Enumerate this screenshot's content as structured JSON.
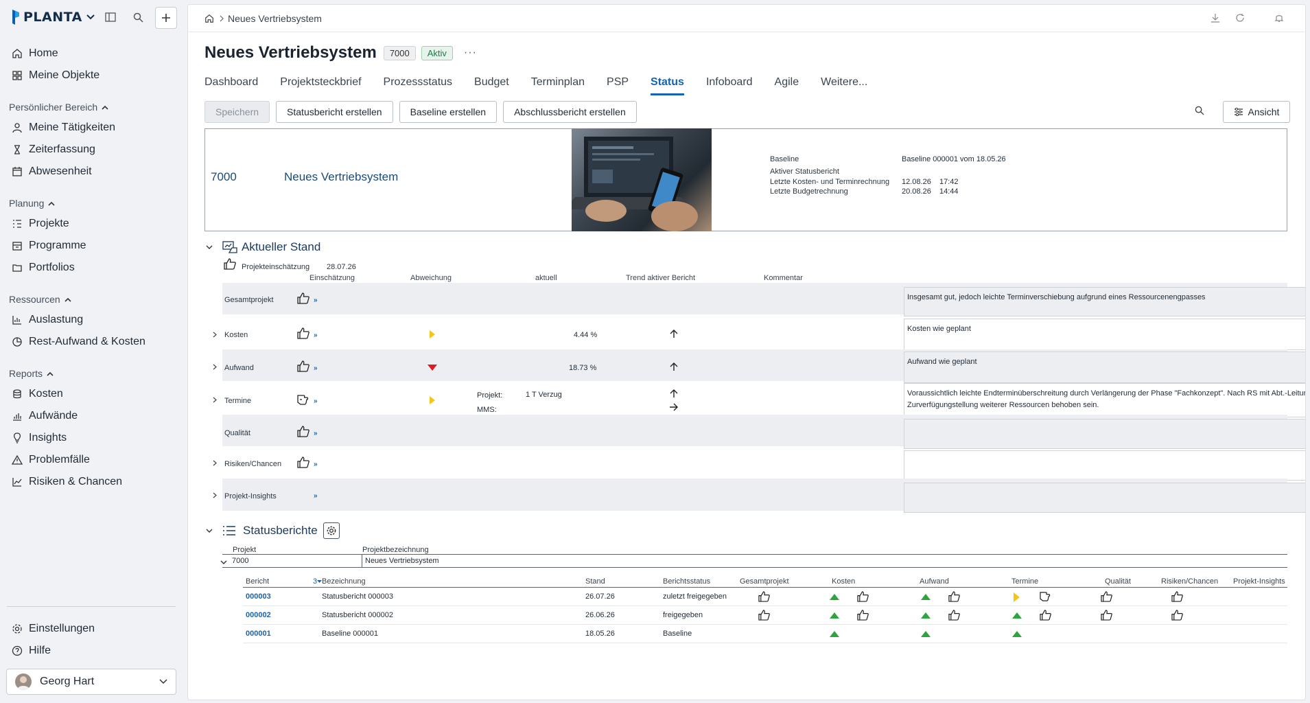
{
  "app": {
    "logo": "PLANTA"
  },
  "sidebar": {
    "top_items": [
      {
        "label": "Home",
        "icon": "home-icon"
      },
      {
        "label": "Meine Objekte",
        "icon": "grid-icon"
      }
    ],
    "sections": [
      {
        "title": "Persönlicher Bereich",
        "items": [
          {
            "label": "Meine Tätigkeiten",
            "icon": "person-icon"
          },
          {
            "label": "Zeiterfassung",
            "icon": "hourglass-icon"
          },
          {
            "label": "Abwesenheit",
            "icon": "calendar-icon"
          }
        ]
      },
      {
        "title": "Planung",
        "items": [
          {
            "label": "Projekte",
            "icon": "list-tree-icon"
          },
          {
            "label": "Programme",
            "icon": "programs-icon"
          },
          {
            "label": "Portfolios",
            "icon": "folder-icon"
          }
        ]
      },
      {
        "title": "Ressourcen",
        "items": [
          {
            "label": "Auslastung",
            "icon": "bar-chart-icon"
          },
          {
            "label": "Rest-Aufwand & Kosten",
            "icon": "pie-chart-icon"
          }
        ]
      },
      {
        "title": "Reports",
        "items": [
          {
            "label": "Kosten",
            "icon": "coins-icon"
          },
          {
            "label": "Aufwände",
            "icon": "effort-icon"
          },
          {
            "label": "Insights",
            "icon": "bulb-icon"
          },
          {
            "label": "Problemfälle",
            "icon": "warning-icon"
          },
          {
            "label": "Risiken & Chancen",
            "icon": "trend-icon"
          }
        ]
      }
    ],
    "bottom_items": [
      {
        "label": "Einstellungen",
        "icon": "gear-icon"
      },
      {
        "label": "Hilfe",
        "icon": "help-icon"
      }
    ],
    "user": {
      "name": "Georg Hart"
    }
  },
  "breadcrumb": {
    "current": "Neues Vertriebsystem"
  },
  "page": {
    "title": "Neues Vertriebsystem",
    "id": "7000",
    "status": "Aktiv",
    "more": "···"
  },
  "tabs": [
    {
      "label": "Dashboard"
    },
    {
      "label": "Projektsteckbrief"
    },
    {
      "label": "Prozessstatus"
    },
    {
      "label": "Budget"
    },
    {
      "label": "Terminplan"
    },
    {
      "label": "PSP"
    },
    {
      "label": "Status",
      "active": true
    },
    {
      "label": "Infoboard"
    },
    {
      "label": "Agile"
    },
    {
      "label": "Weitere..."
    }
  ],
  "toolbar": {
    "save": "Speichern",
    "create_status": "Statusbericht erstellen",
    "create_baseline": "Baseline erstellen",
    "create_final": "Abschlussbericht erstellen",
    "view": "Ansicht"
  },
  "header_card": {
    "id": "7000",
    "name": "Neues Vertriebsystem",
    "baseline_label": "Baseline",
    "baseline_value": "Baseline 000001 vom 18.05.26",
    "active_report_label": "Aktiver Statusbericht",
    "last_cost_label": "Letzte Kosten- und Terminrechnung",
    "last_cost_date": "12.08.26",
    "last_cost_time": "17:42",
    "last_budget_label": "Letzte Budgetrechnung",
    "last_budget_date": "20.08.26",
    "last_budget_time": "14:44"
  },
  "current_state": {
    "title": "Aktueller Stand",
    "assessment_label": "Projekteinschätzung",
    "assessment_date": "28.07.26",
    "columns": {
      "assessment": "Einschätzung",
      "deviation": "Abweichung",
      "current": "aktuell",
      "trend": "Trend aktiver Bericht",
      "comment": "Kommentar"
    },
    "rows": [
      {
        "label": "Gesamtprojekt",
        "comment": "Insgesamt gut, jedoch leichte Terminverschiebung aufgrund eines Ressourcenengpasses"
      },
      {
        "label": "Kosten",
        "current": "4.44 %",
        "comment": "Kosten wie geplant"
      },
      {
        "label": "Aufwand",
        "current": "18.73 %",
        "comment": "Aufwand wie geplant"
      },
      {
        "label": "Termine",
        "project_label": "Projekt:",
        "project_value": "1 T Verzug",
        "mms_label": "MMS:",
        "comment": "Voraussichtlich leichte Endterminüberschreitung durch Verlängerung der Phase \"Fachkonzept\". Nach RS mit Abt.-Leitung wird der Engpass durch Zurverfügungstellung weiterer Ressourcen behoben sein."
      },
      {
        "label": "Qualität",
        "comment": ""
      },
      {
        "label": "Risiken/Chancen",
        "comment": ""
      },
      {
        "label": "Projekt-Insights",
        "comment": ""
      }
    ]
  },
  "status_reports": {
    "title": "Statusberichte",
    "filter": {
      "project_label": "Projekt",
      "name_label": "Projektbezeichnung",
      "project_value": "7000",
      "name_value": "Neues Vertriebsystem"
    },
    "columns": {
      "report": "Bericht",
      "sort": "3",
      "name": "Bezeichnung",
      "date": "Stand",
      "status": "Berichtsstatus",
      "overall": "Gesamtprojekt",
      "costs": "Kosten",
      "effort": "Aufwand",
      "dates": "Termine",
      "quality": "Qualität",
      "risks": "Risiken/Chancen",
      "insights": "Projekt-Insights"
    },
    "rows": [
      {
        "id": "000003",
        "name": "Statusbericht 000003",
        "date": "26.07.26",
        "status": "zuletzt freigegeben"
      },
      {
        "id": "000002",
        "name": "Statusbericht 000002",
        "date": "26.06.26",
        "status": "freigegeben"
      },
      {
        "id": "000001",
        "name": "Baseline 000001",
        "date": "18.05.26",
        "status": "Baseline"
      }
    ]
  },
  "colors": {
    "accent": "#1464b4",
    "green": "#2ea43c",
    "yellow": "#f5c518",
    "red": "#d81e1e"
  }
}
